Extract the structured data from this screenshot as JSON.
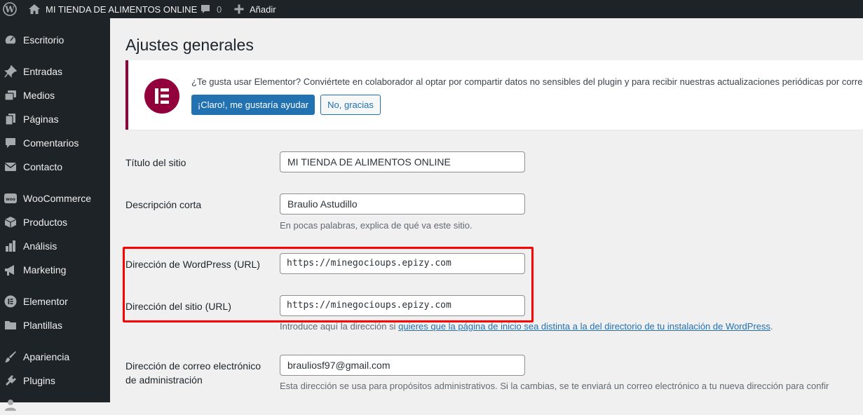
{
  "admin_bar": {
    "site_name": "MI TIENDA DE ALIMENTOS ONLINE",
    "comments_count": "0",
    "add_new_label": "Añadir",
    "icons": [
      "wordpress-logo-icon",
      "home-icon",
      "comment-icon",
      "plus-icon"
    ]
  },
  "sidebar": {
    "items": [
      {
        "label": "Escritorio",
        "icon": "dashboard-icon"
      },
      {
        "label": "Entradas",
        "icon": "pin-icon"
      },
      {
        "label": "Medios",
        "icon": "media-icon"
      },
      {
        "label": "Páginas",
        "icon": "page-icon"
      },
      {
        "label": "Comentarios",
        "icon": "comment-icon"
      },
      {
        "label": "Contacto",
        "icon": "mail-icon"
      },
      {
        "label": "WooCommerce",
        "icon": "woo-icon"
      },
      {
        "label": "Productos",
        "icon": "product-icon"
      },
      {
        "label": "Análisis",
        "icon": "chart-icon"
      },
      {
        "label": "Marketing",
        "icon": "megaphone-icon"
      },
      {
        "label": "Elementor",
        "icon": "elementor-icon"
      },
      {
        "label": "Plantillas",
        "icon": "folder-icon"
      },
      {
        "label": "Apariencia",
        "icon": "brush-icon"
      },
      {
        "label": "Plugins",
        "icon": "plugin-icon"
      }
    ]
  },
  "page": {
    "title": "Ajustes generales"
  },
  "notice": {
    "text": "¿Te gusta usar Elementor? Conviértete en colaborador al optar por compartir datos no sensibles del plugin y para recibir nuestras actualizaciones periódicas por correo",
    "accept_label": "¡Claro!, me gustaría ayudar",
    "decline_label": "No, gracias",
    "brand_color": "#92003b"
  },
  "form": {
    "site_title": {
      "label": "Título del sitio",
      "value": "MI TIENDA DE ALIMENTOS ONLINE"
    },
    "tagline": {
      "label": "Descripción corta",
      "value": "Braulio Astudillo",
      "description": "En pocas palabras, explica de qué va este sitio."
    },
    "wp_url": {
      "label": "Dirección de WordPress (URL)",
      "value": "https://minegocioups.epizy.com"
    },
    "site_url": {
      "label": "Dirección del sitio (URL)",
      "value": "https://minegocioups.epizy.com",
      "description_prefix": "Introduce aquí la dirección si ",
      "description_link": "quieres que la página de inicio sea distinta a la del directorio de tu instalación de WordPress",
      "description_suffix": "."
    },
    "admin_email": {
      "label_line1": "Dirección de correo electrónico",
      "label_line2": "de administración",
      "value": "brauliosf97@gmail.com",
      "description": "Esta dirección se usa para propósitos administrativos. Si la cambias, se te enviará un correo electrónico a tu nueva dirección para confir"
    }
  },
  "colors": {
    "admin_bg": "#1d2327",
    "content_bg": "#f0f0f1",
    "primary": "#2271b1",
    "highlight": "#ff0000"
  }
}
